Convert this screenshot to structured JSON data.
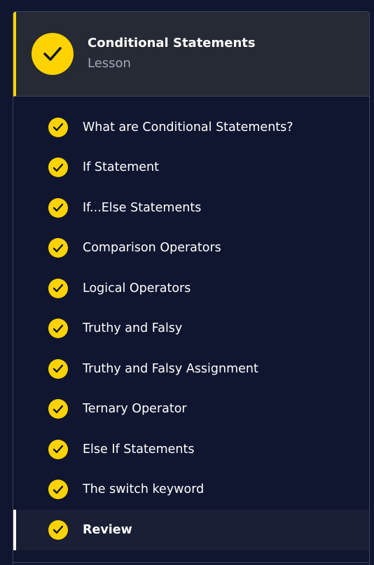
{
  "lesson": {
    "title": "Conditional Statements",
    "subtitle": "Lesson",
    "status_icon": "check-circle-icon"
  },
  "items": [
    {
      "label": "What are Conditional Statements?",
      "completed": true,
      "active": false
    },
    {
      "label": "If Statement",
      "completed": true,
      "active": false
    },
    {
      "label": "If...Else Statements",
      "completed": true,
      "active": false
    },
    {
      "label": "Comparison Operators",
      "completed": true,
      "active": false
    },
    {
      "label": "Logical Operators",
      "completed": true,
      "active": false
    },
    {
      "label": "Truthy and Falsy",
      "completed": true,
      "active": false
    },
    {
      "label": "Truthy and Falsy Assignment",
      "completed": true,
      "active": false
    },
    {
      "label": "Ternary Operator",
      "completed": true,
      "active": false
    },
    {
      "label": "Else If Statements",
      "completed": true,
      "active": false
    },
    {
      "label": "The switch keyword",
      "completed": true,
      "active": false
    },
    {
      "label": "Review",
      "completed": true,
      "active": true
    }
  ],
  "colors": {
    "background": "#10162f",
    "header_bg": "#262a34",
    "accent_yellow": "#ffd300",
    "text": "#ffffff",
    "subtext": "#a3a7b5"
  }
}
